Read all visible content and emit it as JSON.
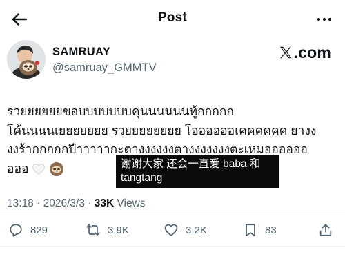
{
  "header": {
    "title": "Post"
  },
  "author": {
    "display_name": "SAMRUAY",
    "handle": "@samruay_GMMTV",
    "avatar": "avatar-person-with-sloth-plush"
  },
  "brand": {
    "logo": "x-logo",
    "text": ".com"
  },
  "post": {
    "lines": [
      "รวยยยยยยขอบบบบบบบคุนนนนนนทู้กกกกก",
      "โค้นนนนเยยยยยยย รวยยยยยยยย โออออออเคคคคคค ยางง",
      "งงร้ากกกกกปีาาาาากะตางงงงงงตางงงงงงงตะเหมออออออ",
      "อออ"
    ],
    "emojis": [
      "white-heart-icon",
      "sloth-icon"
    ]
  },
  "caption": {
    "text": "谢谢大家 还会一直爱 baba 和 tangtang"
  },
  "meta": {
    "time": "13:18",
    "separator": "·",
    "date": "2026/3/3",
    "views_count": "33K",
    "views_label": "Views"
  },
  "actions": {
    "replies": "829",
    "reposts": "3.9K",
    "likes": "3.2K",
    "bookmarks": "83"
  },
  "colors": {
    "text": "#0f1419",
    "secondary": "#536471",
    "divider": "#eff3f4"
  }
}
